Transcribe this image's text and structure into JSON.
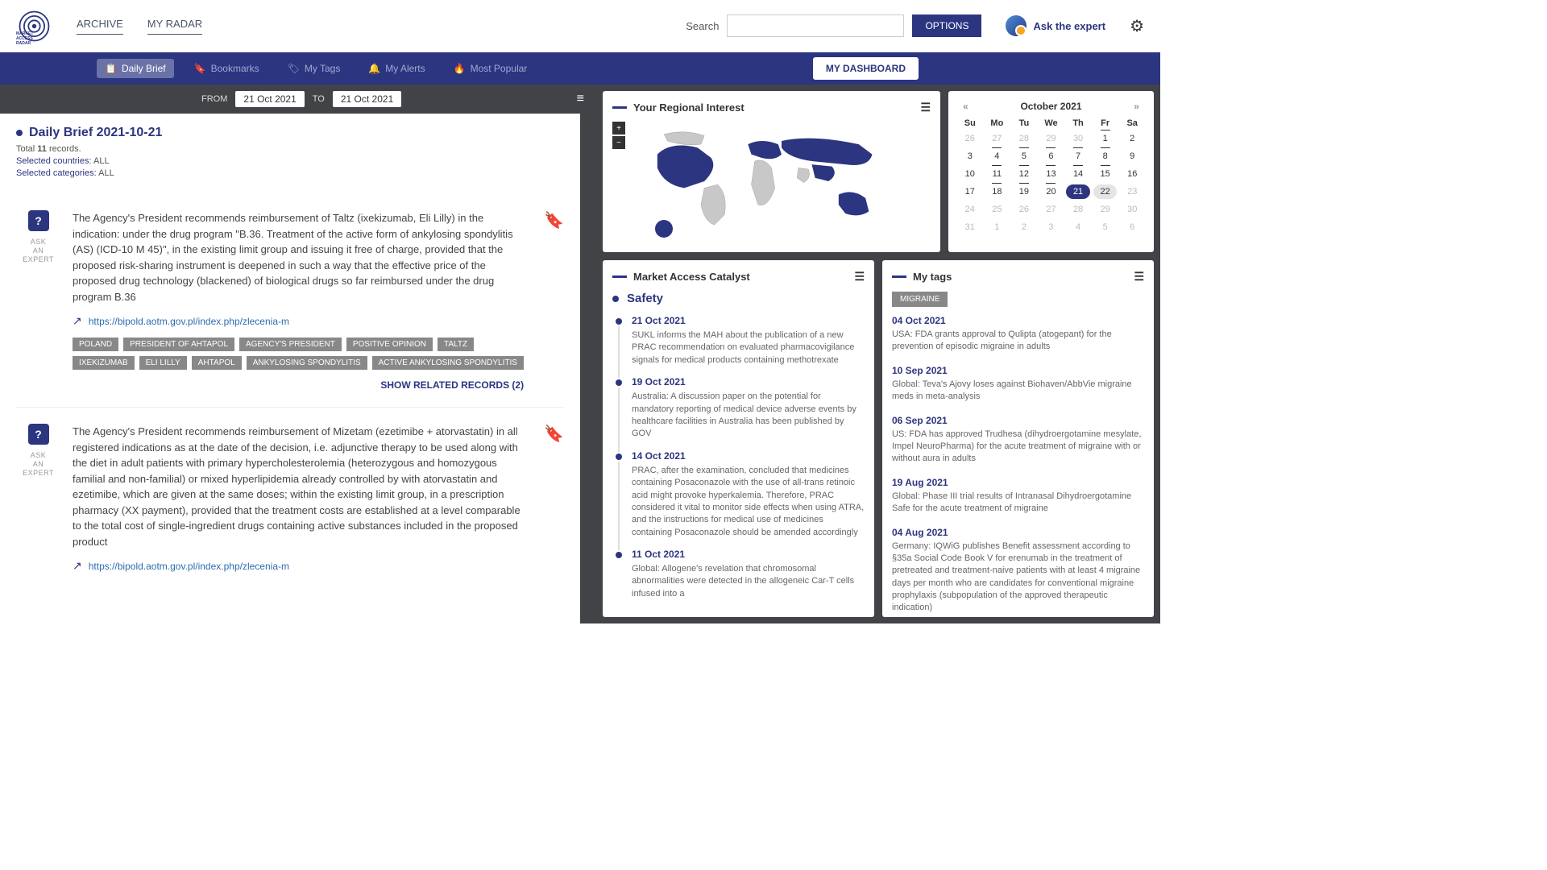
{
  "header": {
    "nav": [
      "ARCHIVE",
      "MY RADAR"
    ],
    "search_label": "Search",
    "options": "OPTIONS",
    "ask_expert": "Ask the expert"
  },
  "bluebar": {
    "tabs": [
      {
        "icon": "📋",
        "label": "Daily Brief",
        "active": true
      },
      {
        "icon": "🔖",
        "label": "Bookmarks"
      },
      {
        "icon": "🏷",
        "label": "My Tags"
      },
      {
        "icon": "🔔",
        "label": "My Alerts"
      },
      {
        "icon": "🔥",
        "label": "Most Popular"
      }
    ],
    "dashboard": "MY DASHBOARD"
  },
  "filter": {
    "from_label": "FROM",
    "from_date": "21 Oct 2021",
    "to_label": "TO",
    "to_date": "21 Oct 2021"
  },
  "brief": {
    "title": "Daily Brief 2021-10-21",
    "total_pre": "Total ",
    "total_n": "11",
    "total_post": " records.",
    "countries_label": "Selected countries: ",
    "countries_val": "ALL",
    "categories_label": "Selected categories: ",
    "categories_val": "ALL"
  },
  "ask": {
    "line1": "ASK",
    "line2": "AN EXPERT"
  },
  "records": [
    {
      "text": "The Agency's President recommends reimbursement of Taltz (ixekizumab, Eli Lilly) in the indication: under the drug program \"B.36. Treatment of the active form of ankylosing spondylitis (AS) (ICD-10 M 45)\", in the existing limit group and issuing it free of charge, provided that the proposed risk-sharing instrument is deepened in such a way that the effective price of the proposed drug technology (blackened) of biological drugs so far reimbursed under the drug program B.36",
      "link": "https://bipold.aotm.gov.pl/index.php/zlecenia-m",
      "tags": [
        "POLAND",
        "PRESIDENT OF AHTAPOL",
        "AGENCY'S PRESIDENT",
        "POSITIVE OPINION",
        "TALTZ",
        "IXEKIZUMAB",
        "ELI LILLY",
        "AHTAPOL",
        "ANKYLOSING SPONDYLITIS",
        "ACTIVE ANKYLOSING SPONDYLITIS"
      ],
      "related": "SHOW RELATED RECORDS (2)"
    },
    {
      "text": "The Agency's President recommends reimbursement of Mizetam (ezetimibe + atorvastatin) in all registered indications as at the date of the decision, i.e. adjunctive therapy to be used along with the diet in adult patients with primary hypercholesterolemia (heterozygous and homozygous familial and non-familial) or mixed hyperlipidemia already controlled by with atorvastatin and ezetimibe, which are given at the same doses; within the existing limit group, in a prescription pharmacy (XX payment), provided that the treatment costs are established at a level comparable to the total cost of single-ingredient drugs containing active substances included in the proposed product",
      "link": "https://bipold.aotm.gov.pl/index.php/zlecenia-m",
      "tags": [],
      "related": ""
    }
  ],
  "regional_title": "Your Regional Interest",
  "calendar": {
    "title": "October 2021",
    "dow": [
      "Su",
      "Mo",
      "Tu",
      "We",
      "Th",
      "Fr",
      "Sa"
    ],
    "days": [
      {
        "d": "26",
        "muted": true
      },
      {
        "d": "27",
        "muted": true
      },
      {
        "d": "28",
        "muted": true
      },
      {
        "d": "29",
        "muted": true
      },
      {
        "d": "30",
        "muted": true
      },
      {
        "d": "1",
        "dot": true
      },
      {
        "d": "2"
      },
      {
        "d": "3"
      },
      {
        "d": "4",
        "dot": true
      },
      {
        "d": "5",
        "dot": true
      },
      {
        "d": "6",
        "dot": true
      },
      {
        "d": "7",
        "dot": true
      },
      {
        "d": "8",
        "dot": true
      },
      {
        "d": "9"
      },
      {
        "d": "10"
      },
      {
        "d": "11",
        "dot": true
      },
      {
        "d": "12",
        "dot": true
      },
      {
        "d": "13",
        "dot": true
      },
      {
        "d": "14",
        "dot": true
      },
      {
        "d": "15",
        "dot": true
      },
      {
        "d": "16"
      },
      {
        "d": "17"
      },
      {
        "d": "18",
        "dot": true
      },
      {
        "d": "19",
        "dot": true
      },
      {
        "d": "20",
        "dot": true
      },
      {
        "d": "21",
        "selected": true
      },
      {
        "d": "22",
        "hover": true
      },
      {
        "d": "23",
        "muted": true
      },
      {
        "d": "24",
        "muted": true
      },
      {
        "d": "25",
        "muted": true
      },
      {
        "d": "26",
        "muted": true
      },
      {
        "d": "27",
        "muted": true
      },
      {
        "d": "28",
        "muted": true
      },
      {
        "d": "29",
        "muted": true
      },
      {
        "d": "30",
        "muted": true
      },
      {
        "d": "31",
        "muted": true
      },
      {
        "d": "1",
        "muted": true
      },
      {
        "d": "2",
        "muted": true
      },
      {
        "d": "3",
        "muted": true
      },
      {
        "d": "4",
        "muted": true
      },
      {
        "d": "5",
        "muted": true
      },
      {
        "d": "6",
        "muted": true
      }
    ]
  },
  "catalyst": {
    "title": "Market Access Catalyst",
    "section": "Safety",
    "items": [
      {
        "date": "21 Oct 2021",
        "text": "SUKL informs the MAH about the publication of a new PRAC recommendation on evaluated pharmacovigilance signals for medical products containing methotrexate"
      },
      {
        "date": "19 Oct 2021",
        "text": "Australia: A discussion paper on the potential for mandatory reporting of medical device adverse events by healthcare facilities in Australia has been published by GOV"
      },
      {
        "date": "14 Oct 2021",
        "text": "PRAC, after the examination, concluded that medicines containing Posaconazole with the use of all-trans retinoic acid might provoke hyperkalemia. Therefore, PRAC considered it vital to monitor side effects when using ATRA, and the instructions for medical use of medicines containing Posaconazole should be amended accordingly"
      },
      {
        "date": "11 Oct 2021",
        "text": "Global: Allogene's revelation that chromosomal abnormalities were detected in the allogeneic Car-T cells infused into a"
      }
    ]
  },
  "mytags": {
    "title": "My tags",
    "chip": "MIGRAINE",
    "items": [
      {
        "date": "04 Oct 2021",
        "text": "USA: FDA grants approval to Qulipta (atogepant) for the prevention of episodic migraine in adults"
      },
      {
        "date": "10 Sep 2021",
        "text": "Global: Teva's Ajovy loses against Biohaven/AbbVie migraine meds in meta-analysis"
      },
      {
        "date": "06 Sep 2021",
        "text": "US: FDA has approved Trudhesa (dihydroergotamine mesylate, Impel NeuroPharma) for the acute treatment of migraine with or without aura in adults"
      },
      {
        "date": "19 Aug 2021",
        "text": "Global: Phase III trial results of Intranasal Dihydroergotamine Safe for the acute treatment of migraine"
      },
      {
        "date": "04 Aug 2021",
        "text": "Germany: IQWiG publishes Benefit assessment according to §35a Social Code Book V for erenumab in the treatment of pretreated and treatment-naive patients with at least 4 migraine days per month who are candidates for conventional migraine prophylaxis (subpopulation of the approved therapeutic indication)"
      }
    ]
  }
}
